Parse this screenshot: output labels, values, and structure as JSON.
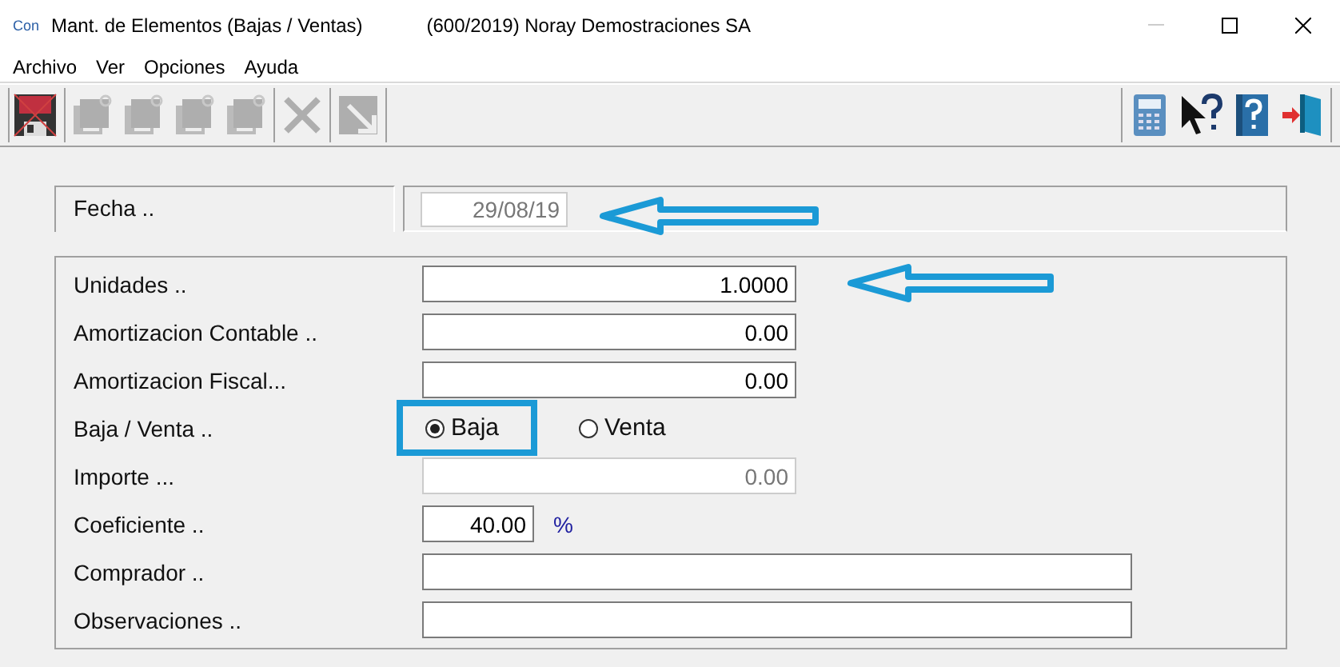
{
  "window": {
    "app_icon": "Con",
    "title": "Mant. de Elementos (Bajas / Ventas)",
    "subtitle": "(600/2019) Noray Demostraciones SA"
  },
  "menu": [
    "Archivo",
    "Ver",
    "Opciones",
    "Ayuda"
  ],
  "toolbar": {
    "left": [
      {
        "kind": "save",
        "disabled": false
      },
      {
        "kind": "record",
        "disabled": true
      },
      {
        "kind": "record",
        "disabled": true
      },
      {
        "kind": "record",
        "disabled": true
      },
      {
        "kind": "record",
        "disabled": true
      },
      {
        "kind": "delete",
        "disabled": true
      },
      {
        "kind": "jump",
        "disabled": true
      }
    ],
    "right": [
      {
        "kind": "calculator",
        "disabled": false
      },
      {
        "kind": "whatsthis",
        "disabled": false
      },
      {
        "kind": "help",
        "disabled": false
      },
      {
        "kind": "exit",
        "disabled": false
      }
    ]
  },
  "header": {
    "label": "Fecha ..",
    "value": "29/08/19",
    "disabled": true,
    "annotated": true
  },
  "fields": [
    {
      "kind": "number",
      "label": "Unidades ..",
      "value": "1.0000",
      "disabled": false,
      "annotated": true
    },
    {
      "kind": "number",
      "label": "Amortizacion Contable ..",
      "value": "0.00",
      "disabled": false,
      "annotated": false
    },
    {
      "kind": "number",
      "label": "Amortizacion Fiscal...",
      "value": "0.00",
      "disabled": false,
      "annotated": false
    },
    {
      "kind": "radio",
      "label": "Baja / Venta ..",
      "options": [
        {
          "label": "Baja",
          "selected": true,
          "highlighted": true
        },
        {
          "label": "Venta",
          "selected": false,
          "highlighted": false
        }
      ]
    },
    {
      "kind": "number",
      "label": "Importe ...",
      "value": "0.00",
      "disabled": true,
      "annotated": false
    },
    {
      "kind": "percent",
      "label": "Coeficiente ..",
      "value": "40.00",
      "unit": "%",
      "disabled": false,
      "annotated": false
    },
    {
      "kind": "text",
      "label": "Comprador ..",
      "disabled": false,
      "annotated": false
    },
    {
      "kind": "text",
      "label": "Observaciones ..",
      "disabled": false,
      "annotated": false
    }
  ]
}
